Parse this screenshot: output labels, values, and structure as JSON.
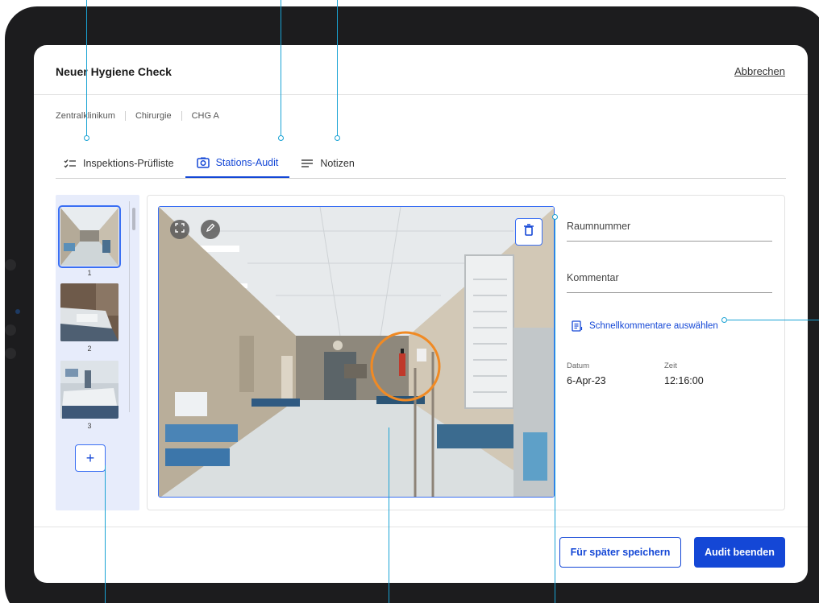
{
  "header": {
    "title": "Neuer Hygiene Check",
    "cancel_label": "Abbrechen"
  },
  "breadcrumb": [
    "Zentralklinikum",
    "Chirurgie",
    "CHG A"
  ],
  "tabs": [
    {
      "label": "Inspektions-Prüfliste",
      "icon": "checklist-icon",
      "active": false
    },
    {
      "label": "Stations-Audit",
      "icon": "camera-icon",
      "active": true
    },
    {
      "label": "Notizen",
      "icon": "notes-icon",
      "active": false
    }
  ],
  "thumbnails": [
    {
      "number": "1",
      "selected": true,
      "scene": "hospital-corridor"
    },
    {
      "number": "2",
      "selected": false,
      "scene": "hospital-bed"
    },
    {
      "number": "3",
      "selected": false,
      "scene": "hospital-bed"
    }
  ],
  "add_photo_label": "+",
  "photo": {
    "scene": "hospital-corridor",
    "highlight": "fire-extinguisher"
  },
  "form": {
    "room_placeholder": "Raumnummer",
    "comment_placeholder": "Kommentar",
    "quick_comments_label": "Schnellkommentare auswählen",
    "date_label": "Datum",
    "date_value": "6-Apr-23",
    "time_label": "Zeit",
    "time_value": "12:16:00"
  },
  "footer": {
    "save_later_label": "Für später speichern",
    "finish_label": "Audit beenden"
  },
  "colors": {
    "accent": "#1447d6",
    "panel": "#e7ecfb",
    "callout": "#1aa3d4",
    "highlight": "#f08a24",
    "device": "#1c1c1e"
  }
}
